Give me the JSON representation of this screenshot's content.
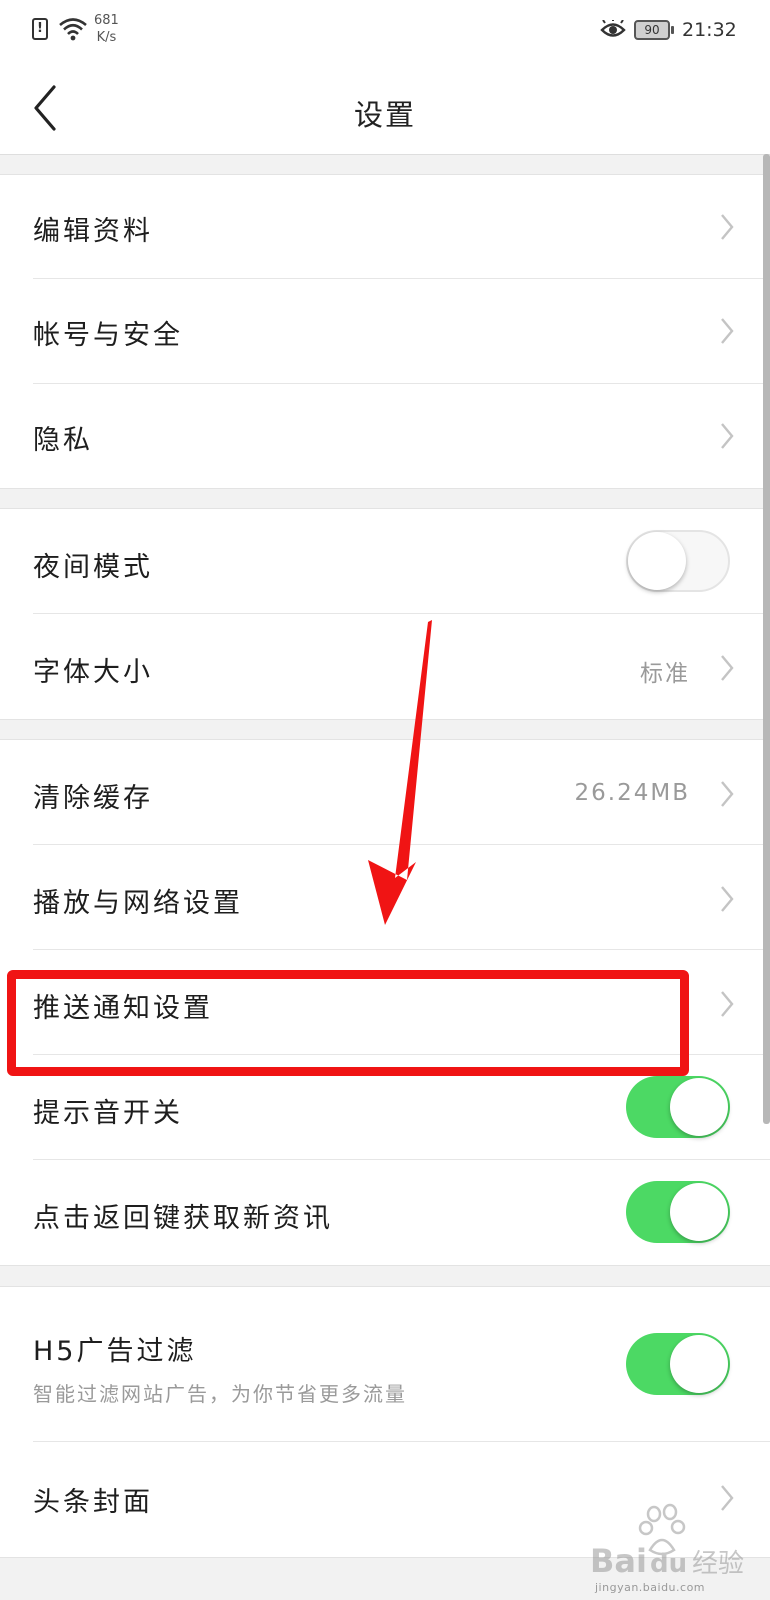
{
  "status_bar": {
    "network_speed_value": "681",
    "network_speed_unit": "K/s",
    "battery": "90",
    "time": "21:32"
  },
  "header": {
    "title": "设置"
  },
  "groups": {
    "account": {
      "edit_profile": "编辑资料",
      "account_security": "帐号与安全",
      "privacy": "隐私"
    },
    "display": {
      "night_mode": "夜间模式",
      "night_mode_on": false,
      "font_size": "字体大小",
      "font_size_value": "标准"
    },
    "general": {
      "clear_cache": "清除缓存",
      "cache_size": "26.24MB",
      "playback_network": "播放与网络设置",
      "push_notifications": "推送通知设置",
      "sound_switch": "提示音开关",
      "sound_switch_on": true,
      "back_refresh": "点击返回键获取新资讯",
      "back_refresh_on": true
    },
    "content": {
      "h5_ad_filter": "H5广告过滤",
      "h5_ad_filter_desc": "智能过滤网站广告，为你节省更多流量",
      "h5_ad_filter_on": true,
      "headline_cover": "头条封面"
    }
  },
  "annotation": {
    "highlight_color": "#f01414",
    "arrow_color": "#f01414"
  },
  "watermark": {
    "site": "jingyan.baidu.com"
  },
  "colors": {
    "toggle_on": "#4cd964",
    "background": "#f2f2f2"
  }
}
